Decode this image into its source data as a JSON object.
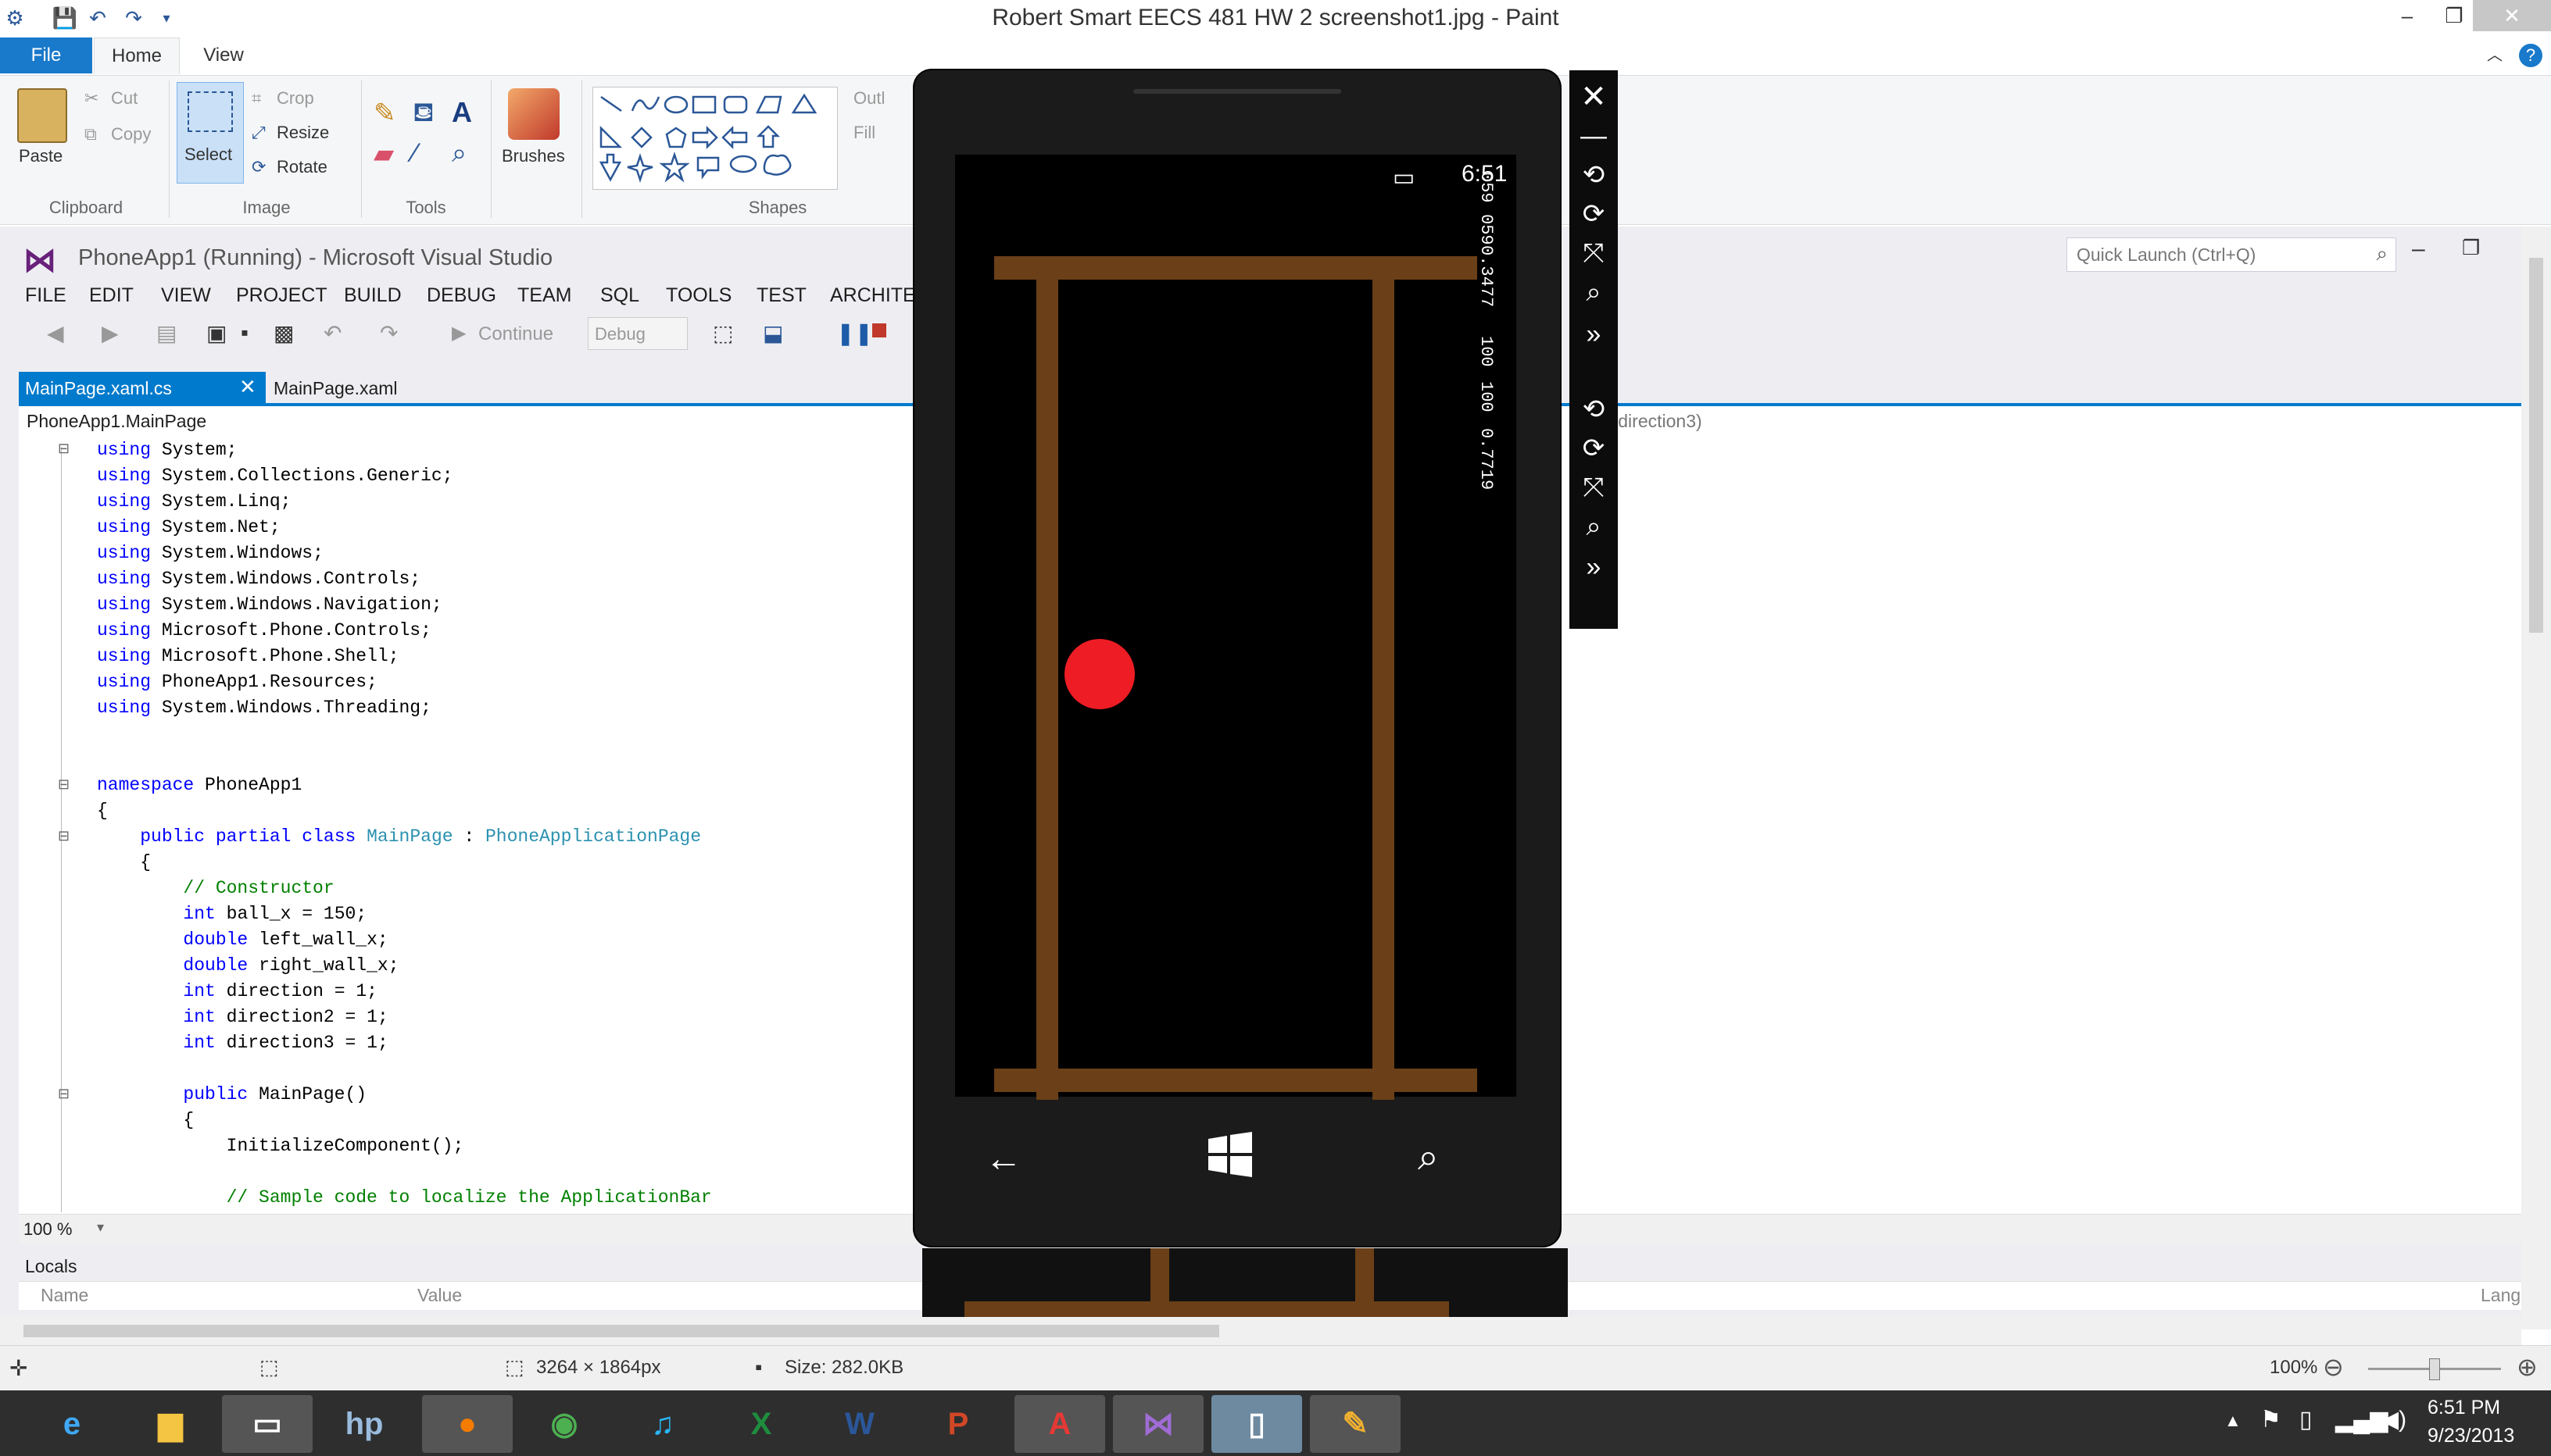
{
  "paint": {
    "window_title": "Robert Smart EECS 481 HW 2 screenshot1.jpg - Paint",
    "tabs": [
      "File",
      "Home",
      "View"
    ],
    "clipboard": {
      "paste": "Paste",
      "cut": "Cut",
      "copy": "Copy",
      "label": "Clipboard"
    },
    "image": {
      "select": "Select",
      "crop": "Crop",
      "resize": "Resize",
      "rotate": "Rotate",
      "label": "Image"
    },
    "tools": {
      "label": "Tools"
    },
    "brushes": {
      "label": "Brushes"
    },
    "shapes": {
      "label": "Shapes",
      "outline": "Outl",
      "fill": "Fill"
    },
    "status": {
      "dimensions": "3264 × 1864px",
      "size": "Size: 282.0KB",
      "zoom": "100%"
    }
  },
  "vs": {
    "title": "PhoneApp1 (Running) - Microsoft Visual Studio",
    "quick_launch": "Quick Launch (Ctrl+Q)",
    "menu": [
      "FILE",
      "EDIT",
      "VIEW",
      "PROJECT",
      "BUILD",
      "DEBUG",
      "TEAM",
      "SQL",
      "TOOLS",
      "TEST",
      "ARCHITEC"
    ],
    "toolbar": {
      "continue": "Continue",
      "config": "Debug"
    },
    "doc_tabs": [
      "MainPage.xaml.cs",
      "MainPage.xaml"
    ],
    "nav_left": "PhoneApp1.MainPage",
    "nav_right": "2, int direction3)",
    "zoom": "100 %",
    "locals": {
      "title": "Locals",
      "col_name": "Name",
      "col_value": "Value",
      "col_lang": "Lang"
    }
  },
  "code": [
    "using System;",
    "using System.Collections.Generic;",
    "using System.Linq;",
    "using System.Net;",
    "using System.Windows;",
    "using System.Windows.Controls;",
    "using System.Windows.Navigation;",
    "using Microsoft.Phone.Controls;",
    "using Microsoft.Phone.Shell;",
    "using PhoneApp1.Resources;",
    "using System.Windows.Threading;",
    "",
    "",
    "namespace PhoneApp1",
    "{",
    "    public partial class MainPage : PhoneApplicationPage",
    "    {",
    "        // Constructor",
    "        int ball_x = 150;",
    "        double left_wall_x;",
    "        double right_wall_x;",
    "        int direction = 1;",
    "        int direction2 = 1;",
    "        int direction3 = 1;",
    "",
    "        public MainPage()",
    "        {",
    "            InitializeComponent();",
    "",
    "            // Sample code to localize the ApplicationBar"
  ],
  "phone": {
    "time": "6:51",
    "counters": [
      "059",
      "059",
      "0.3477",
      "100",
      "100",
      "0.7719"
    ]
  },
  "taskbar": {
    "time": "6:51 PM",
    "date": "9/23/2013"
  }
}
